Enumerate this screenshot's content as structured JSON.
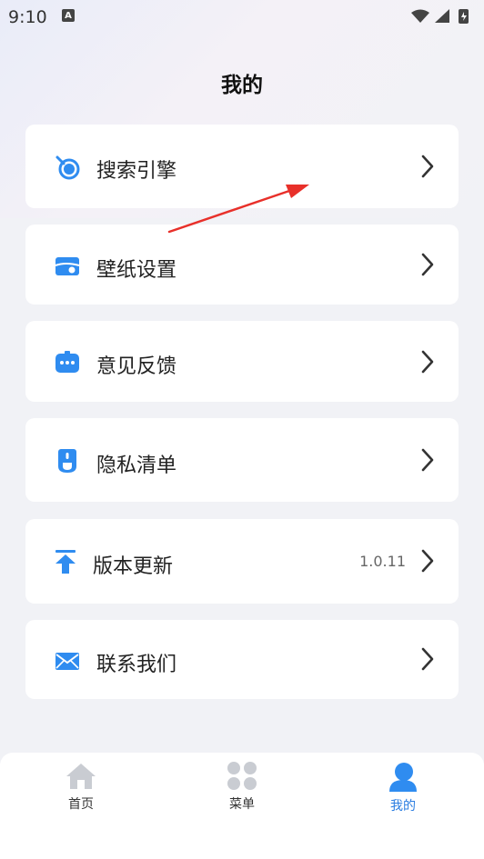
{
  "status": {
    "time": "9:10",
    "notif_glyph": "A"
  },
  "header": {
    "title": "我的"
  },
  "menu": [
    {
      "label": "搜索引擎",
      "icon": "search-engine-icon",
      "value": ""
    },
    {
      "label": "壁纸设置",
      "icon": "wallpaper-icon",
      "value": ""
    },
    {
      "label": "意见反馈",
      "icon": "feedback-icon",
      "value": ""
    },
    {
      "label": "隐私清单",
      "icon": "privacy-icon",
      "value": ""
    },
    {
      "label": "版本更新",
      "icon": "update-icon",
      "value": "1.0.11"
    },
    {
      "label": "联系我们",
      "icon": "mail-icon",
      "value": ""
    }
  ],
  "tabs": [
    {
      "label": "首页",
      "icon": "home-icon",
      "active": false
    },
    {
      "label": "菜单",
      "icon": "grid-icon",
      "active": false
    },
    {
      "label": "我的",
      "icon": "person-icon",
      "active": true
    }
  ],
  "colors": {
    "accent": "#2a7de1",
    "icon_blue": "#2f8cf0",
    "annotation_arrow": "#e8302a"
  }
}
